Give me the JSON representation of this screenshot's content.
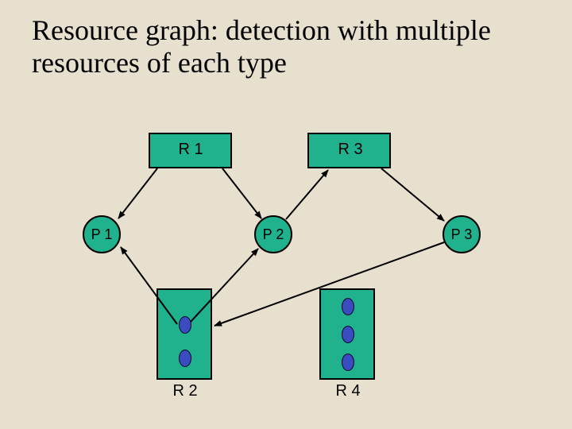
{
  "title": "Resource graph: detection with multiple resources of each type",
  "r1": "R 1",
  "r2": "R 2",
  "r3": "R 3",
  "r4": "R 4",
  "p1": "P 1",
  "p2": "P 2",
  "p3": "P 3"
}
